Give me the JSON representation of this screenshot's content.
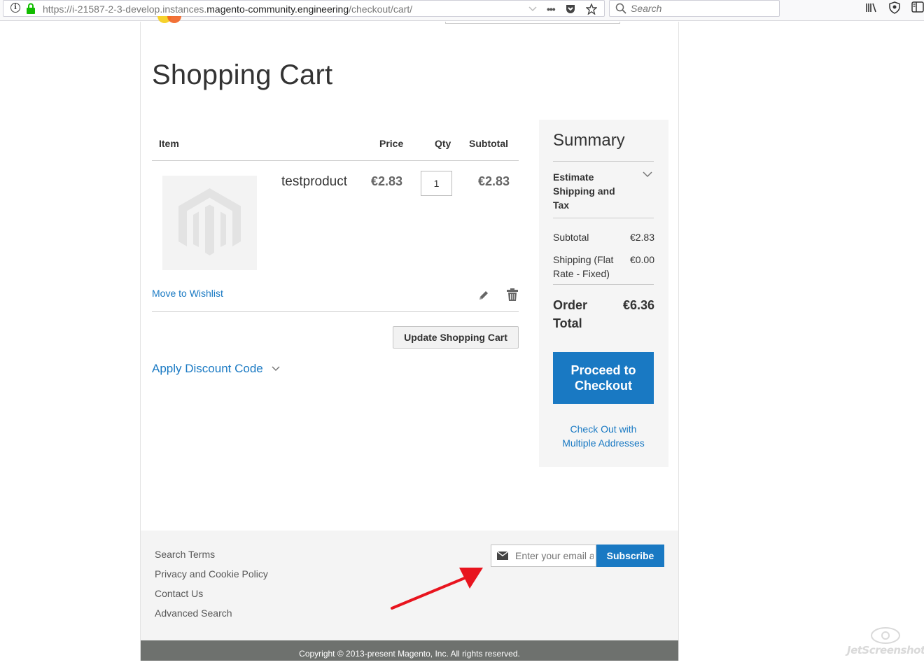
{
  "browser": {
    "url_prefix": "https://i-21587-2-3-develop.instances.",
    "url_host": "magento-community.engineering",
    "url_path": "/checkout/cart/",
    "search_placeholder": "Search",
    "more_label": "•••"
  },
  "page": {
    "title": "Shopping Cart"
  },
  "cart": {
    "headers": {
      "item": "Item",
      "price": "Price",
      "qty": "Qty",
      "subtotal": "Subtotal"
    },
    "item": {
      "name": "testproduct",
      "price": "€2.83",
      "qty": "1",
      "subtotal": "€2.83"
    },
    "move_to_wishlist": "Move to Wishlist",
    "update_button": "Update Shopping Cart",
    "discount_label": "Apply Discount Code"
  },
  "summary": {
    "title": "Summary",
    "estimate_label": "Estimate Shipping and Tax",
    "subtotal_label": "Subtotal",
    "subtotal_value": "€2.83",
    "shipping_label": "Shipping (Flat Rate - Fixed)",
    "shipping_value": "€0.00",
    "order_total_label": "Order Total",
    "order_total_value": "€6.36",
    "checkout_button": "Proceed to Checkout",
    "multi_address_link": "Check Out with Multiple Addresses"
  },
  "footer": {
    "links": [
      "Search Terms",
      "Privacy and Cookie Policy",
      "Contact Us",
      "Advanced Search"
    ],
    "newsletter_placeholder": "Enter your email address",
    "subscribe_button": "Subscribe",
    "copyright": "Copyright © 2013-present Magento, Inc. All rights reserved."
  },
  "watermark": "JetScreenshot",
  "colors": {
    "link": "#1979c3",
    "primary_button": "#1979c3",
    "annotation_arrow": "#e8141e"
  }
}
